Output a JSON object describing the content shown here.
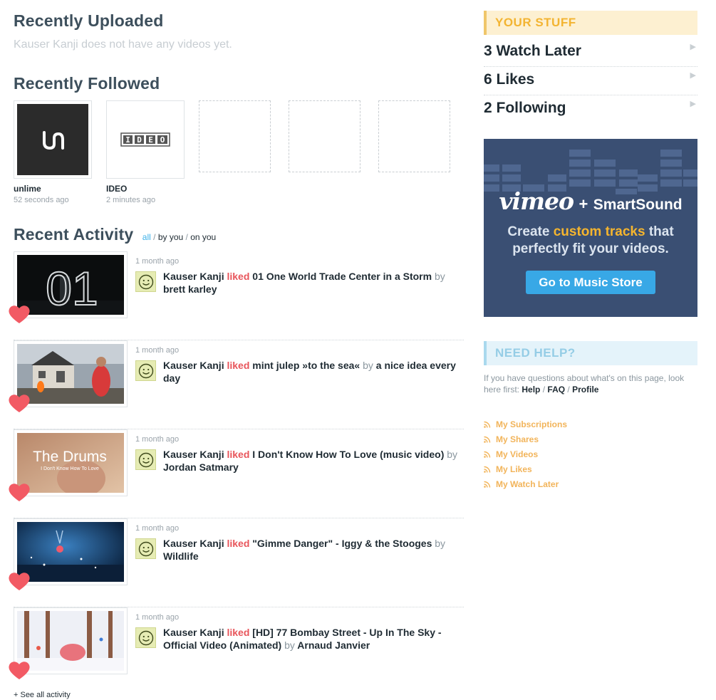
{
  "uploaded": {
    "title": "Recently Uploaded",
    "empty_text": "Kauser Kanji does not have any videos yet."
  },
  "followed": {
    "title": "Recently Followed",
    "items": [
      {
        "name": "unlime",
        "time": "52 seconds ago",
        "logo": "un"
      },
      {
        "name": "IDEO",
        "time": "2 minutes ago",
        "logo": "IDEO"
      }
    ]
  },
  "activity": {
    "title": "Recent Activity",
    "filters": {
      "all": "all",
      "sep": "/",
      "by_you": "by you",
      "on_you": "on you"
    },
    "items": [
      {
        "time": "1 month ago",
        "user": "Kauser Kanji",
        "verb": "liked",
        "video": "01 One World Trade Center in a Storm",
        "by": "by",
        "author": "brett karley",
        "thumb_text": "01"
      },
      {
        "time": "1 month ago",
        "user": "Kauser Kanji",
        "verb": "liked",
        "video": "mint julep »to the sea«",
        "by": "by",
        "author": "a nice idea every day"
      },
      {
        "time": "1 month ago",
        "user": "Kauser Kanji",
        "verb": "liked",
        "video": "I Don't Know How To Love (music video)",
        "by": "by",
        "author": "Jordan Satmary",
        "thumb_text": "The Drums",
        "thumb_sub": "I Don't Know How To Love"
      },
      {
        "time": "1 month ago",
        "user": "Kauser Kanji",
        "verb": "liked",
        "video": "\"Gimme Danger\" - Iggy & the Stooges",
        "by": "by",
        "author": "Wildlife"
      },
      {
        "time": "1 month ago",
        "user": "Kauser Kanji",
        "verb": "liked",
        "video": "[HD] 77 Bombay Street - Up In The Sky - Official Video (Animated)",
        "by": "by",
        "author": "Arnaud Janvier"
      }
    ],
    "see_all": "+ See all activity"
  },
  "sidebar": {
    "stuff_title": "YOUR STUFF",
    "stuff_items": [
      {
        "label": "3 Watch Later",
        "arrow": "▶"
      },
      {
        "label": "6 Likes",
        "arrow": "▶"
      },
      {
        "label": "2 Following",
        "arrow": "▶"
      }
    ],
    "ad": {
      "brand1": "vimeo",
      "plus": "+",
      "brand2": "SmartSound",
      "line1_pre": "Create ",
      "line1_hl": "custom tracks",
      "line1_post": " that",
      "line2": "perfectly fit your videos.",
      "button": "Go to Music Store"
    },
    "help_title": "NEED HELP?",
    "help_text": "If you have questions about what's on this page, look here first:",
    "help_links": [
      "Help",
      "FAQ",
      "Profile"
    ],
    "help_sep": "/",
    "feeds": [
      "My Subscriptions",
      "My Shares",
      "My Videos",
      "My Likes",
      "My Watch Later"
    ]
  },
  "colors": {
    "accent_blue": "#3bb0e8",
    "liked_red": "#e8555b",
    "feed_orange": "#f2b45a",
    "stuff_gold": "#f3b431"
  }
}
